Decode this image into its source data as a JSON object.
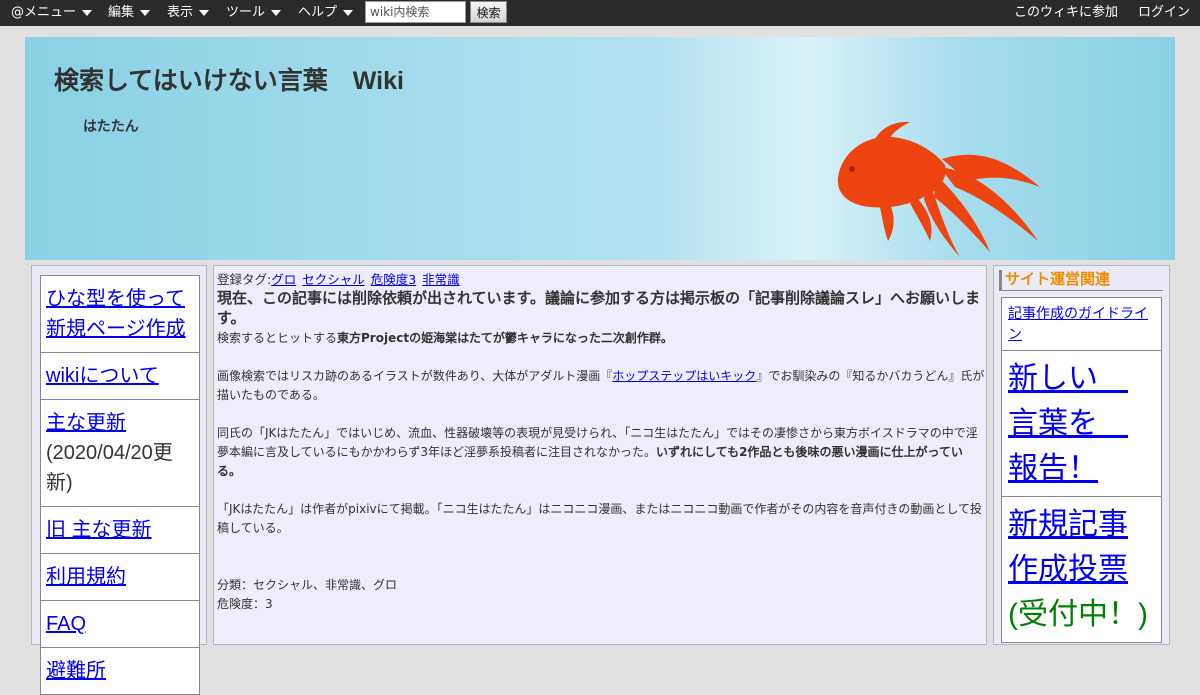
{
  "topbar": {
    "menus": [
      "@メニュー",
      "編集",
      "表示",
      "ツール",
      "ヘルプ"
    ],
    "search_placeholder": "wiki内検索",
    "search_button": "検索",
    "join_link": "このウィキに参加",
    "login_link": "ログイン"
  },
  "header": {
    "title": "検索してはいけない言葉　Wiki",
    "subtitle": "はたたん"
  },
  "left_menu": {
    "items": [
      {
        "label": "ひな型を使って新規ページ作成"
      },
      {
        "label": "wikiについて"
      },
      {
        "label": "主な更新",
        "note": "(2020/04/20更新)"
      },
      {
        "label": "旧 主な更新"
      },
      {
        "label": "利用規約"
      },
      {
        "label": "FAQ"
      },
      {
        "label": "避難所"
      }
    ]
  },
  "article": {
    "tags_label": "登録タグ:",
    "tags": [
      "グロ",
      "セクシャル",
      "危険度3",
      "非常識"
    ],
    "notice": "現在、この記事には削除依頼が出されています。議論に参加する方は掲示板の「記事削除議論スレ」へお願いします。",
    "intro_prefix": "検索するとヒットする",
    "intro_bold": "東方Projectの姫海棠はたてが鬱キャラになった二次創作群。",
    "para1_before": "画像検索ではリスカ跡のあるイラストが数件あり、大体がアダルト漫画『",
    "para1_link": "ホップステップはいキック",
    "para1_after": "』でお馴染みの『知るかバカうどん』氏が描いたものである。",
    "para2_text": "同氏の「JKはたたん」ではいじめ、流血、性器破壊等の表現が見受けられ、「ニコ生はたたん」ではその凄惨さから東方ボイスドラマの中で淫夢本編に言及しているにもかかわらず3年ほど淫夢系投稿者に注目されなかった。",
    "para2_bold": "いずれにしても2作品とも後味の悪い漫画に仕上がっている。",
    "para3": "「JKはたたん」は作者がpixivにて掲載。「ニコ生はたたん」はニコニコ漫画、またはニコニコ動画で作者がその内容を音声付きの動画として投稿している。",
    "category": "分類：セクシャル、非常識、グロ",
    "danger": "危険度：3"
  },
  "right_menu": {
    "heading": "サイト運営関連",
    "items": [
      {
        "label": "記事作成のガイドライン"
      },
      {
        "label": "新しい　言葉を　報告！"
      },
      {
        "label": "新規記事作成投票",
        "note": "(受付中！)"
      }
    ]
  },
  "colors": {
    "topbar": "#2b2b2b",
    "banner": "#89d1e5",
    "goldfish": "#ee4410",
    "heading_orange": "#f08c00",
    "note_green": "#008000",
    "link": "#0000ee"
  }
}
